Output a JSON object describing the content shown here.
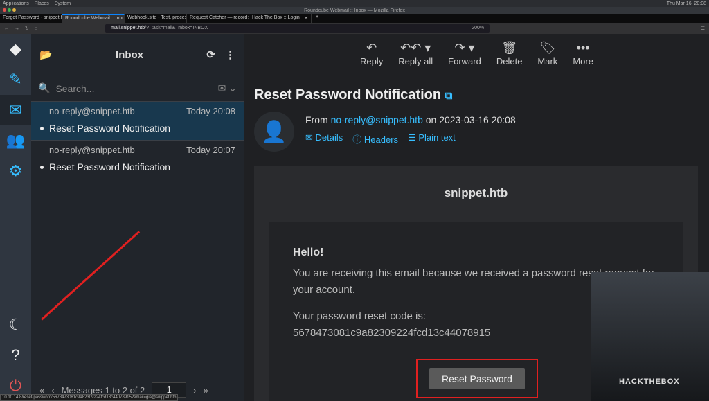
{
  "system": {
    "menus": [
      "Applications",
      "Places",
      "System"
    ],
    "clock": "Thu Mar 16, 20:08"
  },
  "window_title": "Roundcube Webmail :: Inbox — Mozilla Firefox",
  "tabs": [
    {
      "label": "Forgot Password - snippet.htb"
    },
    {
      "label": "Roundcube Webmail :: Inbox"
    },
    {
      "label": "Webhook.site - Test, process"
    },
    {
      "label": "Request Catcher — record"
    },
    {
      "label": "Hack The Box :: Login"
    }
  ],
  "url": {
    "host": "mail.snippet.htb",
    "path": "/?_task=mail&_mbox=INBOX",
    "zoom": "200%"
  },
  "list": {
    "title": "Inbox",
    "search_placeholder": "Search...",
    "messages": [
      {
        "from": "no-reply@snippet.htb",
        "time": "Today 20:08",
        "subject": "Reset Password Notification"
      },
      {
        "from": "no-reply@snippet.htb",
        "time": "Today 20:07",
        "subject": "Reset Password Notification"
      }
    ],
    "pager": "Messages 1 to 2 of 2",
    "page": "1"
  },
  "toolbar": {
    "reply": "Reply",
    "reply_all": "Reply all",
    "forward": "Forward",
    "delete": "Delete",
    "mark": "Mark",
    "more": "More"
  },
  "message": {
    "subject": "Reset Password Notification",
    "from_label": "From",
    "from": "no-reply@snippet.htb",
    "on": "on 2023-03-16 20:08",
    "details": "Details",
    "headers": "Headers",
    "plain": "Plain text",
    "site": "snippet.htb",
    "hello": "Hello!",
    "p1": "You are receiving this email because we received a password reset request for your account.",
    "p2": "Your password reset code is:",
    "code": "5678473081c9a82309224fcd13c44078915",
    "button": "Reset Password"
  },
  "statusbar": "10.10.14.8/reset-password/5678473081c9a82309224fcd13c44078915?email=gia@snippet.htb",
  "webcam_logo": "HACKTHEBOX"
}
